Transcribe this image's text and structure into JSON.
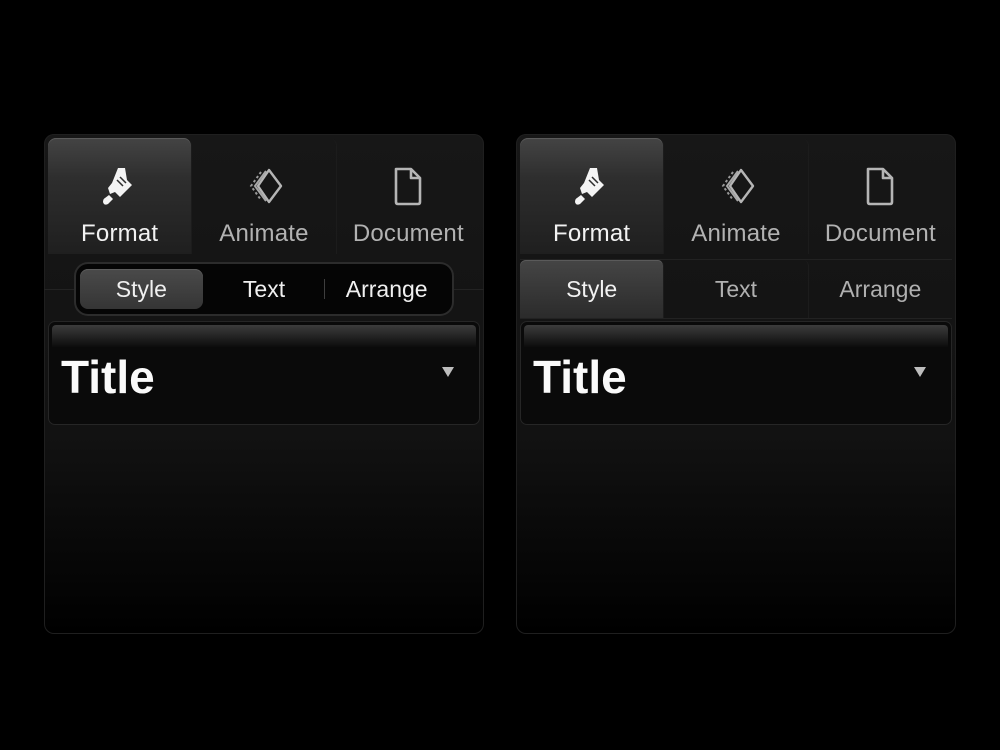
{
  "tabs": [
    {
      "label": "Format",
      "icon": "paintbrush-icon"
    },
    {
      "label": "Animate",
      "icon": "animate-diamond-icon"
    },
    {
      "label": "Document",
      "icon": "document-icon"
    }
  ],
  "subtabs": [
    {
      "label": "Style"
    },
    {
      "label": "Text"
    },
    {
      "label": "Arrange"
    }
  ],
  "style_selector": {
    "value": "Title",
    "caret_icon": "triangle-down-icon"
  },
  "colors": {
    "background": "#000000",
    "active_tab": "#3a3a3a",
    "text_active": "#f2f2f2",
    "text_inactive": "#b2b2b2"
  }
}
